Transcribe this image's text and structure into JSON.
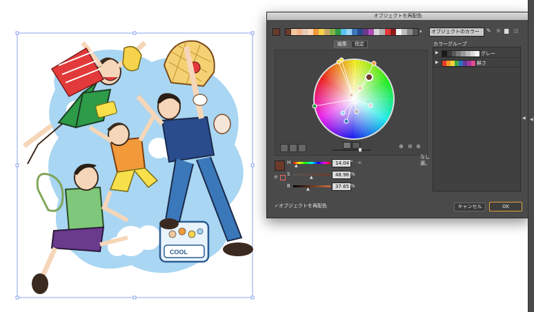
{
  "dialog": {
    "title": "オブジェクトを再配色",
    "preset": "オブジェクトのカラー",
    "tabs": [
      "編集",
      "指定"
    ],
    "color_groups_label": "カラーグループ",
    "groups": [
      {
        "name": "グレー"
      },
      {
        "name": "鮮さ"
      }
    ],
    "hsb": {
      "h_label": "H",
      "h_value": "14.04",
      "h_unit": "°",
      "s_label": "S",
      "s_value": "48.96",
      "s_unit": "%",
      "b_label": "B",
      "b_value": "37.65",
      "b_unit": "%"
    },
    "none_label": "なし",
    "none_label2": "選。",
    "recolor_check_label": "✓オブジェクトを再配色",
    "cancel": "キャンセル",
    "ok": "OK",
    "base_color": "#6b3a2a",
    "accent": "#e6a33b"
  },
  "colors": {
    "strip": [
      "#6b3a2a",
      "#f1c79e",
      "#f2b48f",
      "#e9c9b8",
      "#ffd7b5",
      "#f29a3a",
      "#f7d24b",
      "#c8a96c",
      "#7fb54a",
      "#2d9b48",
      "#5cc3ee",
      "#9cd3f2",
      "#3b78b9",
      "#2a4b8c",
      "#6a3a8c",
      "#b04fb3",
      "#d8d8d8",
      "#b2b2b2",
      "#e23a3a",
      "#8e1c1c",
      "#f4f4f4",
      "#bdbdbd",
      "#8a8a8a",
      "#575757"
    ],
    "group_gray": [
      "#1a1a1a",
      "#3a3a3a",
      "#5a5a5a",
      "#7a7a7a",
      "#9a9a9a",
      "#bababa",
      "#dadada",
      "#f2f2f2"
    ],
    "group_vivid": [
      "#e63a2e",
      "#f39a24",
      "#f4d13b",
      "#3aa84a",
      "#2d6fc3",
      "#6a3a99",
      "#a33aa0",
      "#e34c8c"
    ]
  }
}
